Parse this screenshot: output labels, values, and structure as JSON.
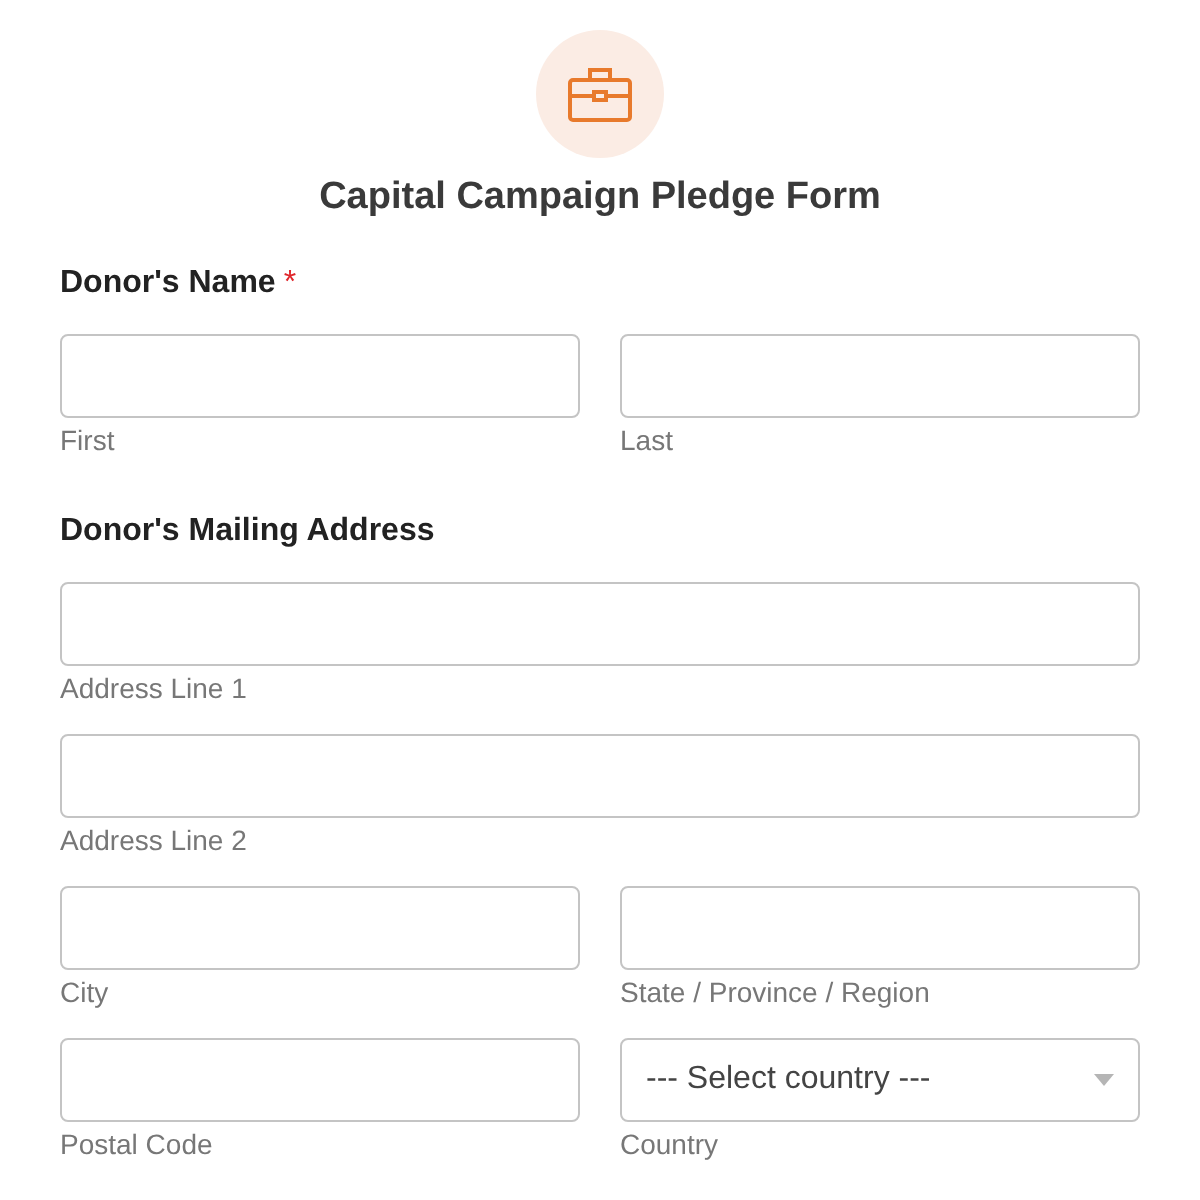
{
  "form": {
    "title": "Capital Campaign Pledge Form"
  },
  "sections": [
    {
      "label": "Donor's Name",
      "required_mark": "*",
      "rows": [
        [
          {
            "kind": "text",
            "sublabel": "First"
          },
          {
            "kind": "text",
            "sublabel": "Last"
          }
        ]
      ]
    },
    {
      "label": "Donor's Mailing Address",
      "rows": [
        [
          {
            "kind": "text",
            "sublabel": "Address Line 1"
          }
        ],
        [
          {
            "kind": "text",
            "sublabel": "Address Line 2"
          }
        ],
        [
          {
            "kind": "text",
            "sublabel": "City"
          },
          {
            "kind": "text",
            "sublabel": "State / Province / Region"
          }
        ],
        [
          {
            "kind": "text",
            "sublabel": "Postal Code"
          },
          {
            "kind": "select",
            "placeholder": "--- Select country ---",
            "sublabel": "Country"
          }
        ]
      ]
    }
  ]
}
